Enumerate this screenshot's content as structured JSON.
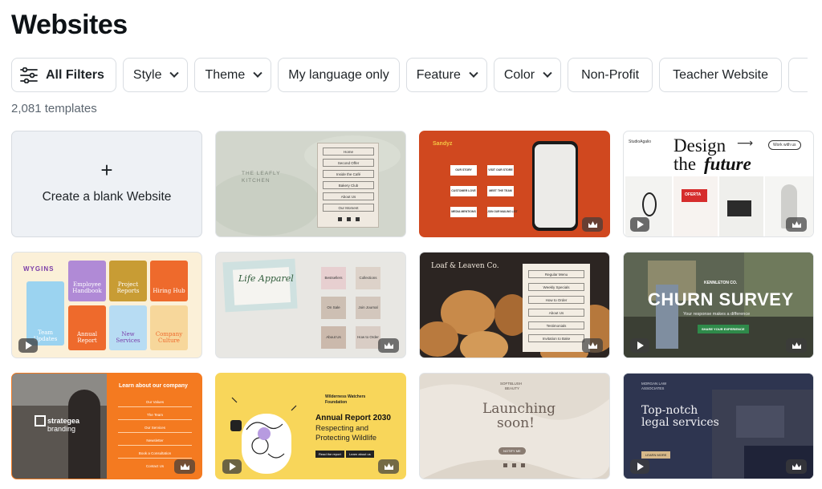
{
  "page": {
    "title": "Websites",
    "count": "2,081 templates"
  },
  "filters": [
    {
      "label": "All Filters"
    },
    {
      "label": "Style"
    },
    {
      "label": "Theme"
    },
    {
      "label": "My language only"
    },
    {
      "label": "Feature"
    },
    {
      "label": "Color"
    },
    {
      "label": "Non-Profit"
    },
    {
      "label": "Teacher Website"
    }
  ],
  "blank_card": {
    "label": "Create a blank Website"
  },
  "templates": {
    "leafly": {
      "brand": "THE LEAFLY KITCHEN",
      "menu": [
        "Home",
        "Second Offer",
        "Inside the Café",
        "Bakery Club",
        "About Us",
        "Our Moment"
      ]
    },
    "sandyz": {
      "brand": "Sandyz",
      "buttons": [
        "OUR STORY",
        "VISIT OUR STORE",
        "CUSTOMER LOVE",
        "MEET THE TEAM",
        "MEDIA MENTIONS",
        "JOIN OUR MAILING LIST"
      ]
    },
    "design": {
      "brand": "StudioAgalio",
      "nav": "Work with us",
      "line1": "Design",
      "line2a": "the",
      "line2b": "future",
      "promo": "OFERTA"
    },
    "wygins": {
      "brand": "WYGINS",
      "tiles": [
        "Employee Handbook",
        "Project Reports",
        "Hiring Hub",
        "Team Updates",
        "Annual Report",
        "New Services",
        "Company Culture"
      ]
    },
    "life": {
      "title": "Life Apparel",
      "notes": [
        "Bestsellers",
        "Collections",
        "On Sale",
        "Join Journal",
        "About Us",
        "How to Order"
      ]
    },
    "loaf": {
      "title": "Loaf & Leaven Co.",
      "menu": [
        "Regular Menu",
        "Weekly Specials",
        "How to Order",
        "About Us",
        "Testimonials",
        "Invitation to Bake"
      ]
    },
    "churn": {
      "brand": "KENNLETON CO.",
      "title": "CHURN SURVEY",
      "subtitle": "Your response makes a difference",
      "cta": "SHARE YOUR EXPERIENCE"
    },
    "strategea": {
      "heading": "Learn about our company",
      "brand_line1": "strategea",
      "brand_line2": "branding",
      "menu": [
        "Our Values",
        "The Team",
        "Our Services",
        "Newsletter",
        "Book a Consultation",
        "Contact Us"
      ]
    },
    "wilderness": {
      "org_line1": "Wilderness Watchers",
      "org_line2": "Foundation",
      "title": "Annual Report 2030",
      "sub1": "Respecting and",
      "sub2": "Protecting Wildlife",
      "btn1": "Read the report",
      "btn2": "Learn about us"
    },
    "launch": {
      "brand_line1": "SOFTBLUSH",
      "brand_line2": "BEAUTY",
      "line1": "Launching",
      "line2": "soon!",
      "cta": "NOTIFY ME"
    },
    "legal": {
      "brand_line1": "MORGAN LAW",
      "brand_line2": "ASSOCIATES",
      "line1": "Top-notch",
      "line2": "legal services",
      "cta": "LEARN MORE"
    }
  },
  "colors": {
    "accent": "#8b3dff",
    "border": "#d9dde2",
    "text": "#0d1216"
  },
  "icons": {
    "filters": "sliders-icon",
    "dropdown": "chevron-down-icon",
    "premium": "crown-icon",
    "video": "play-icon"
  }
}
